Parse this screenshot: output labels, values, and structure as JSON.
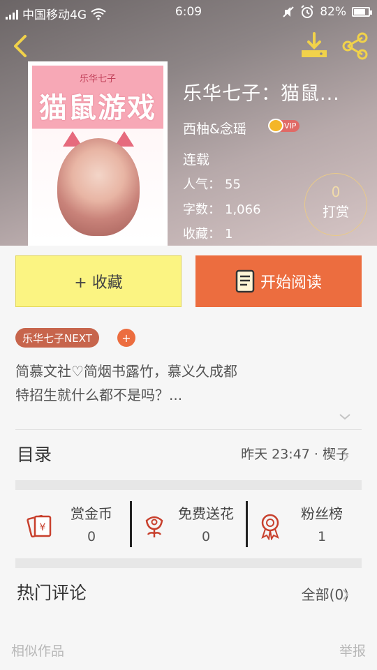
{
  "status_bar": {
    "carrier": "中国移动4G",
    "time": "6:09",
    "battery": "82%",
    "battery_level": 0.82
  },
  "book": {
    "title": "乐华七子：猫鼠...",
    "author": "西柚&念瑶",
    "vip": "VIP",
    "status": "连载",
    "popularity_label": "人气：",
    "popularity_value": "55",
    "words_label": "字数：",
    "words_value": "1,066",
    "favorites_label": "收藏：",
    "favorites_value": "1",
    "cover": {
      "top_text": "乐华七子",
      "title_text": "猫鼠游戏"
    }
  },
  "reward": {
    "count": "0",
    "label": "打赏"
  },
  "actions": {
    "favorite_label": "+ 收藏",
    "read_label": "开始阅读"
  },
  "tag": {
    "label": "乐华七子NEXT",
    "add": "+"
  },
  "description": {
    "line1": "简慕文社♡简烟书露竹，慕义久成都",
    "line2": "特招生就什么都不是吗？..."
  },
  "toc": {
    "label": "目录",
    "update": "昨天 23:47 · 楔子"
  },
  "stats": [
    {
      "label": "赏金币",
      "value": "0",
      "icon": "red-envelope-icon"
    },
    {
      "label": "免费送花",
      "value": "0",
      "icon": "flower-icon"
    },
    {
      "label": "粉丝榜",
      "value": "1",
      "icon": "medal-icon"
    }
  ],
  "hot_comments": {
    "label": "热门评论",
    "all": "全部(0)"
  },
  "footer": {
    "similar": "相似作品",
    "report": "举报"
  },
  "colors": {
    "accent_orange": "#ec6d3f",
    "favorite_yellow": "#fbf482",
    "tag_brown": "#c7654c",
    "icon_red": "#c8402d"
  }
}
